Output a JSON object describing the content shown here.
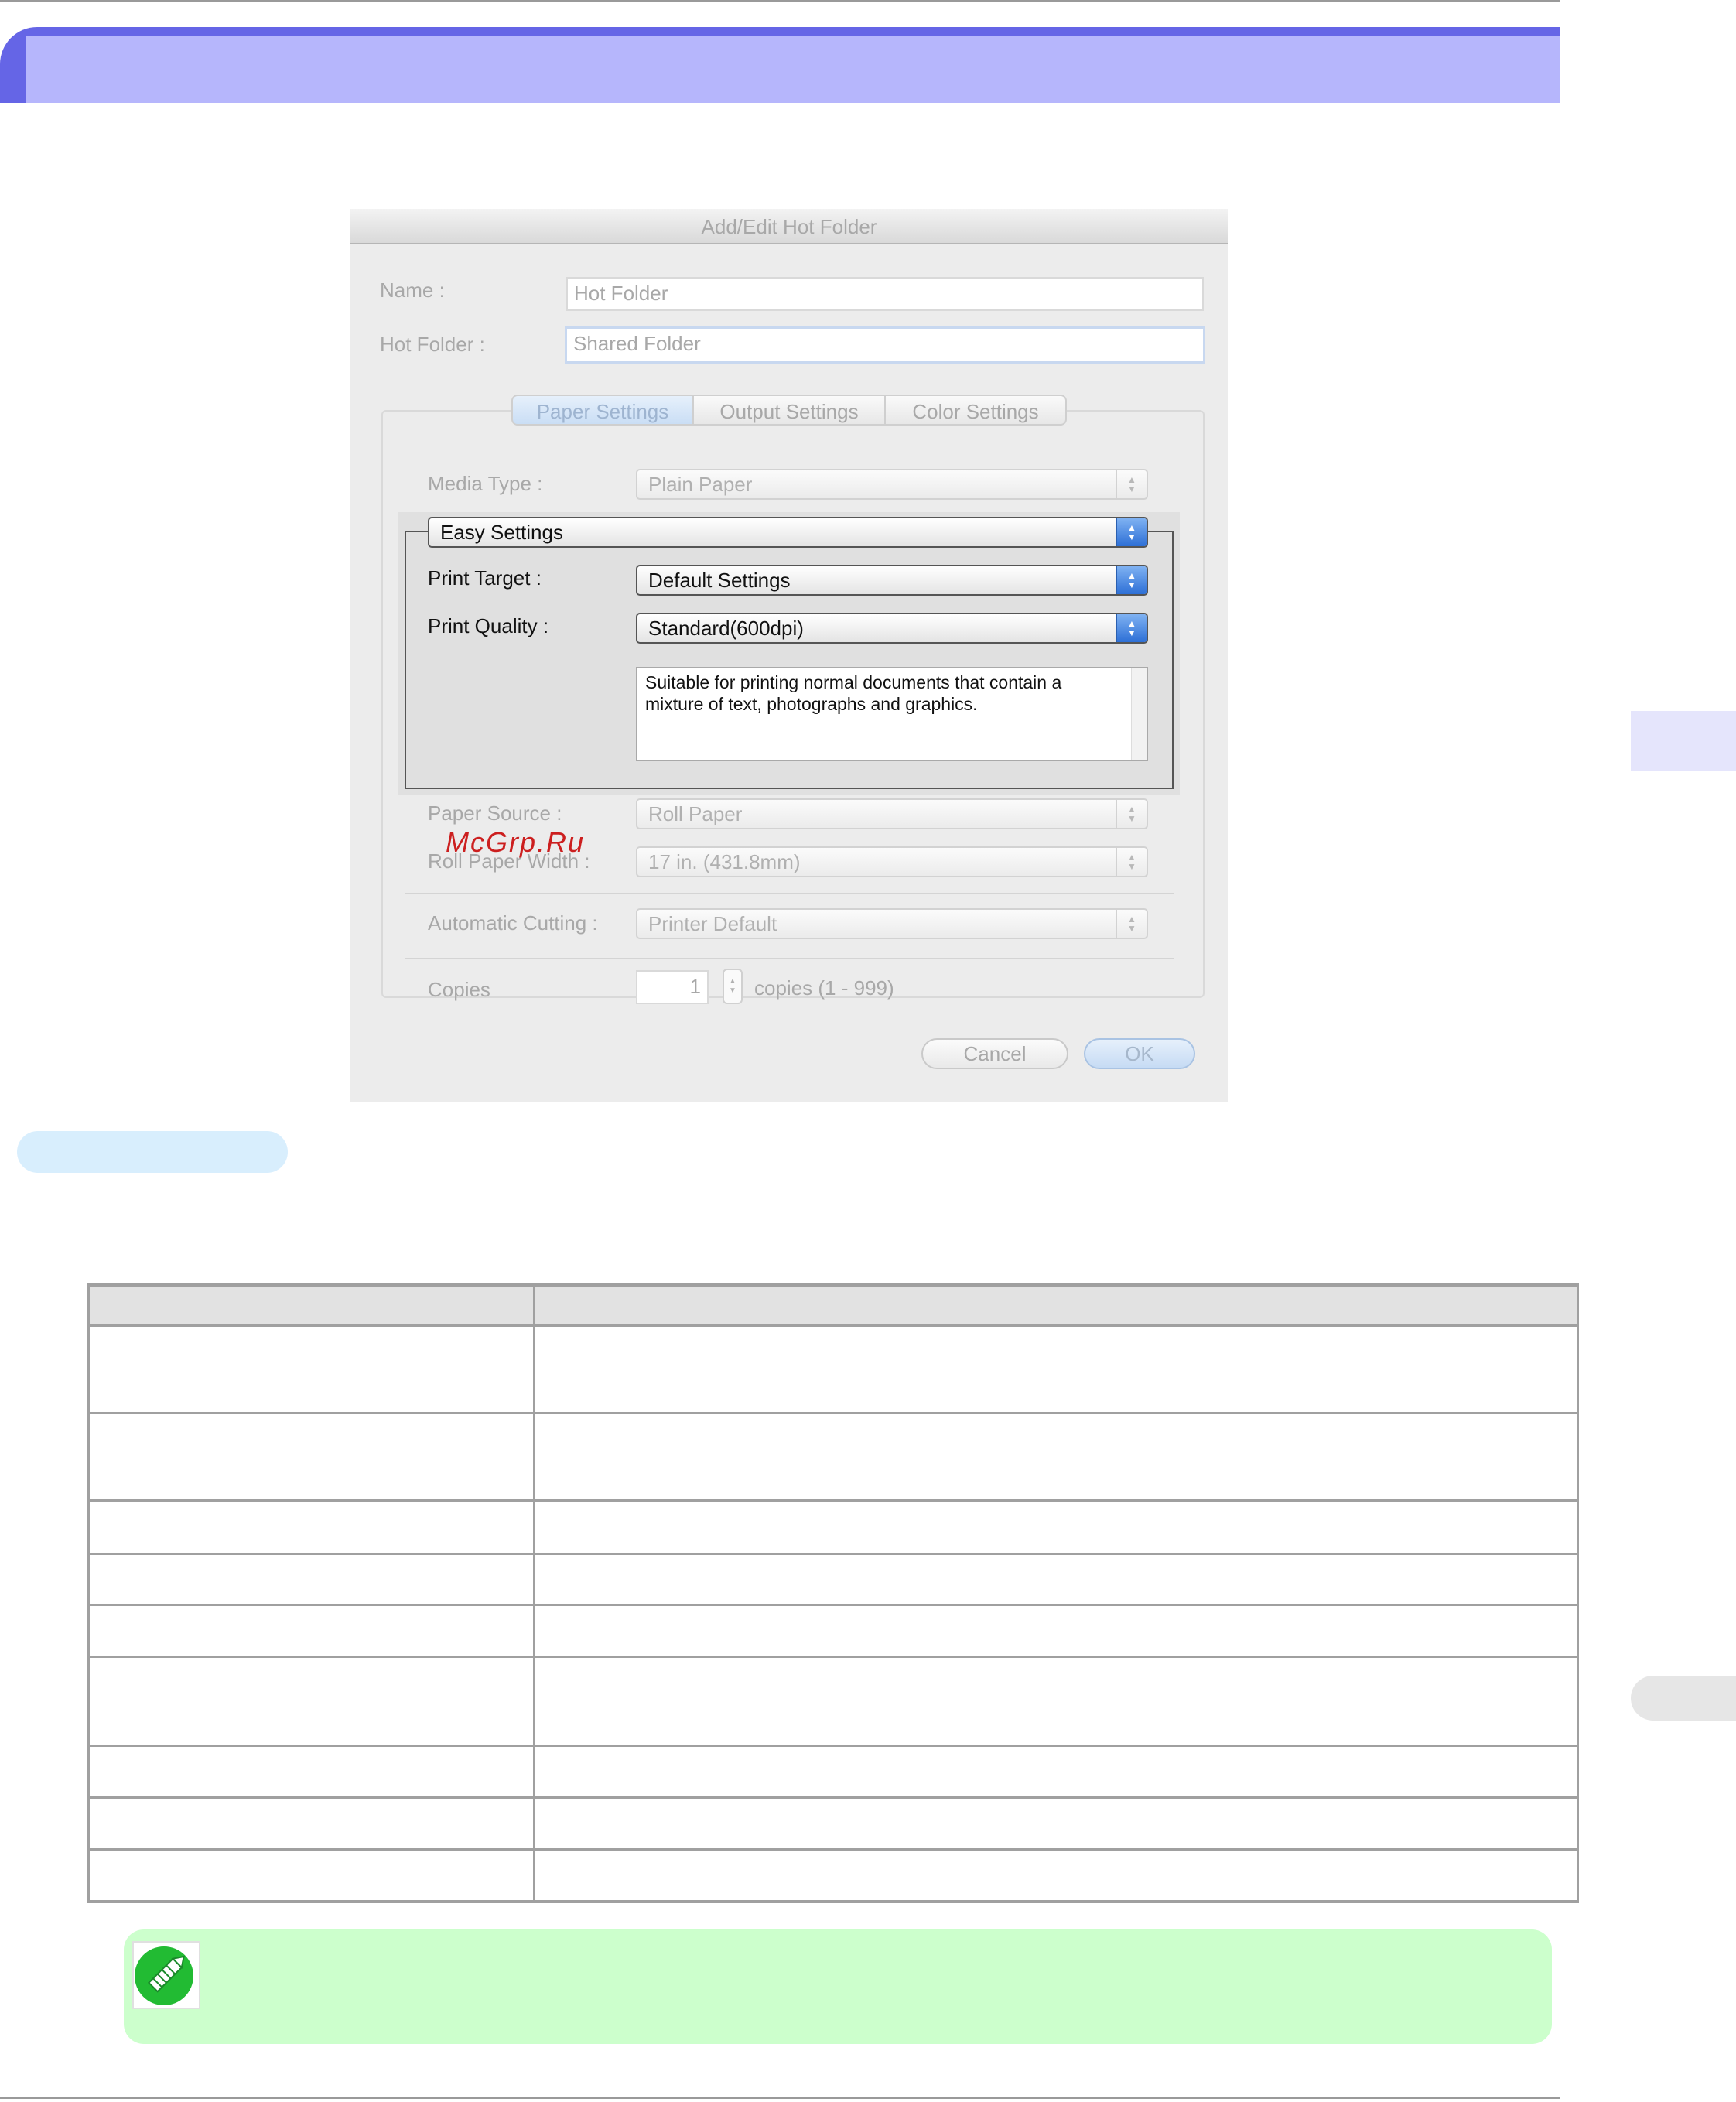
{
  "dialog": {
    "title": "Add/Edit Hot Folder",
    "name_label": "Name :",
    "name_value": "Hot Folder",
    "hot_folder_label": "Hot Folder :",
    "hot_folder_value": "Shared Folder",
    "tabs": [
      "Paper Settings",
      "Output Settings",
      "Color Settings"
    ],
    "media_type_label": "Media Type :",
    "media_type_value": "Plain Paper",
    "easy_settings_value": "Easy Settings",
    "print_target_label": "Print Target :",
    "print_target_value": "Default Settings",
    "print_quality_label": "Print Quality :",
    "print_quality_value": "Standard(600dpi)",
    "description": "Suitable for printing normal documents that contain a mixture of text, photographs and graphics.",
    "paper_source_label": "Paper Source :",
    "paper_source_value": "Roll Paper",
    "roll_width_label": "Roll Paper Width :",
    "roll_width_value": "17 in. (431.8mm)",
    "auto_cut_label": "Automatic Cutting :",
    "auto_cut_value": "Printer Default",
    "copies_label": "Copies",
    "copies_value": "1",
    "copies_range": "copies (1 - 999)",
    "cancel_label": "Cancel",
    "ok_label": "OK"
  },
  "watermark": "McGrp.Ru",
  "icons": {
    "popup_arrows": "up-down-chevron-icon",
    "stepper": "stepper-icon",
    "note": "pencil-note-icon"
  },
  "colors": {
    "heading_bar": "#6565e6",
    "heading_bar_light": "#b6b6fc",
    "note_background": "#ccffcc",
    "note_icon": "#22bb33",
    "watermark": "#cc1f1f"
  }
}
